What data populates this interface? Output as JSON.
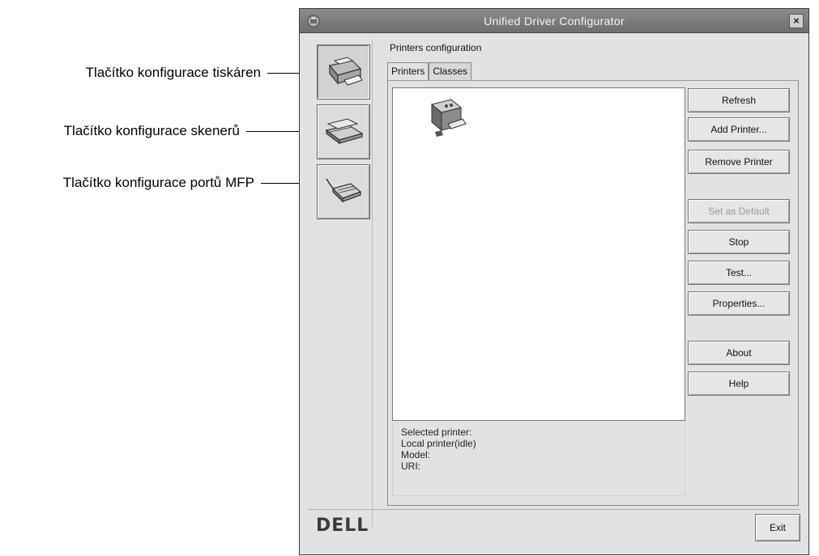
{
  "callouts": {
    "printers": "Tlačítko konfigurace tiskáren",
    "scanners": "Tlačítko konfigurace skenerů",
    "ports": "Tlačítko konfigurace portů MFP"
  },
  "window": {
    "title": "Unified Driver Configurator",
    "close_label": "×"
  },
  "group_label": "Printers configuration",
  "tabs": [
    {
      "label": "Printers",
      "active": true
    },
    {
      "label": "Classes",
      "active": false
    }
  ],
  "buttons": {
    "refresh": "Refresh",
    "add_printer": "Add Printer...",
    "remove_printer": "Remove Printer",
    "set_default": "Set as Default",
    "stop": "Stop",
    "test": "Test...",
    "properties": "Properties...",
    "about": "About",
    "help": "Help",
    "exit": "Exit"
  },
  "selected_printer": {
    "heading": "Selected printer:",
    "status": "Local printer(idle)",
    "model": "Model:",
    "uri": "URI:"
  },
  "logo": "DELL",
  "icons": {
    "app": "app-icon",
    "printers_nav": "printer-icon",
    "scanners_nav": "scanner-icon",
    "ports_nav": "port-icon",
    "printer_item": "printer-icon"
  }
}
